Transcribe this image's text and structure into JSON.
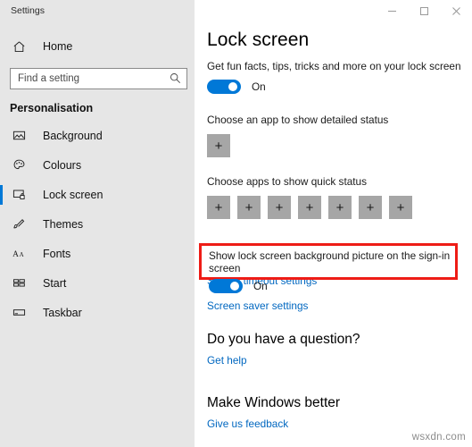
{
  "window": {
    "title": "Settings",
    "minimize_label": "Minimize",
    "maximize_label": "Maximize",
    "close_label": "Close"
  },
  "sidebar": {
    "home_label": "Home",
    "search": {
      "placeholder": "Find a setting",
      "value": "",
      "icon": "search-icon"
    },
    "section_title": "Personalisation",
    "items": [
      {
        "label": "Background",
        "icon": "picture-icon",
        "selected": false
      },
      {
        "label": "Colours",
        "icon": "palette-icon",
        "selected": false
      },
      {
        "label": "Lock screen",
        "icon": "lock-screen-icon",
        "selected": true
      },
      {
        "label": "Themes",
        "icon": "brush-icon",
        "selected": false
      },
      {
        "label": "Fonts",
        "icon": "font-aa-icon",
        "selected": false
      },
      {
        "label": "Start",
        "icon": "start-tiles-icon",
        "selected": false
      },
      {
        "label": "Taskbar",
        "icon": "taskbar-icon",
        "selected": false
      }
    ]
  },
  "main": {
    "page_title": "Lock screen",
    "fun_facts": {
      "label": "Get fun facts, tips, tricks and more on your lock screen",
      "toggle_state": "On"
    },
    "detailed_status": {
      "label": "Choose an app to show detailed status",
      "tile_glyph": "+"
    },
    "quick_status": {
      "label": "Choose apps to show quick status",
      "tile_glyph": "+",
      "tile_count": 7
    },
    "sign_in_background": {
      "label": "Show lock screen background picture on the sign-in screen",
      "toggle_state": "On",
      "highlight_color": "#ee1c16"
    },
    "links": [
      {
        "label": "Screen timeout settings"
      },
      {
        "label": "Screen saver settings"
      }
    ],
    "question_section": {
      "heading": "Do you have a question?",
      "link": "Get help"
    },
    "feedback_section": {
      "heading": "Make Windows better",
      "link": "Give us feedback"
    }
  },
  "watermark": "wsxdn.com",
  "colors": {
    "accent": "#0078d7",
    "link": "#0067c0",
    "sidebar_bg": "#e6e6e6",
    "tile_bg": "#a6a6a6",
    "highlight": "#ee1c16"
  }
}
